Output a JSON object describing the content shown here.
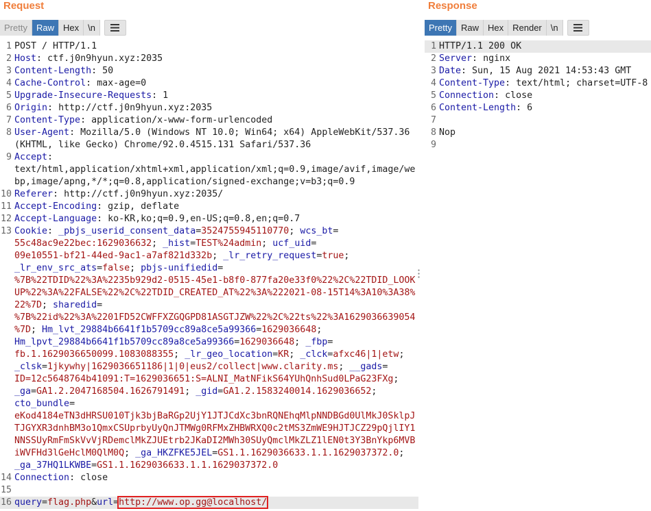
{
  "request": {
    "title": "Request",
    "tabs": {
      "pretty": "Pretty",
      "raw": "Raw",
      "hex": "Hex",
      "newline": "\\n"
    },
    "lines": {
      "l1": "POST / HTTP/1.1",
      "host_k": "Host",
      "host_v": " ctf.j0n9hyun.xyz:2035",
      "cl_k": "Content-Length",
      "cl_v": " 50",
      "cc_k": "Cache-Control",
      "cc_v": " max-age=0",
      "uir_k": "Upgrade-Insecure-Requests",
      "uir_v": " 1",
      "or_k": "Origin",
      "or_v": " http://ctf.j0n9hyun.xyz:2035",
      "ct_k": "Content-Type",
      "ct_v": " application/x-www-form-urlencoded",
      "ua_k": "User-Agent",
      "ua_v": " Mozilla/5.0 (Windows NT 10.0; Win64; x64) AppleWebKit/537.36",
      "ua_v2": "(KHTML, like Gecko) Chrome/92.0.4515.131 Safari/537.36",
      "ac_k": "Accept",
      "ac_v1": "text/html,application/xhtml+xml,application/xml;q=0.9,image/avif,image/we",
      "ac_v2": "bp,image/apng,*/*;q=0.8,application/signed-exchange;v=b3;q=0.9",
      "ref_k": "Referer",
      "ref_v": " http://ctf.j0n9hyun.xyz:2035/",
      "ae_k": "Accept-Encoding",
      "ae_v": " gzip, deflate",
      "al_k": "Accept-Language",
      "al_v": " ko-KR,ko;q=0.9,en-US;q=0.8,en;q=0.7",
      "ck_k": "Cookie",
      "ck1a": "_pbjs_userid_consent_data",
      "ck1b": "3524755945110770",
      "ck1c": "wcs_bt",
      "ck2a": "55c48ac9e22bec:1629036632",
      "ck2b": "_hist",
      "ck2c": "TEST%24admin",
      "ck2d": "ucf_uid",
      "ck3a": "09e10551-bf21-44ed-9ac1-a7af821d332b",
      "ck3b": "_lr_retry_request",
      "ck3c": "true",
      "ck4a": "_lr_env_src_ats",
      "ck4b": "false",
      "ck4c": "pbjs-unifiedid",
      "ck5": "%7B%22TDID%22%3A%2235b929d2-0515-45e1-b8f0-877fa20e33f0%22%2C%22TDID_LOOK",
      "ck6": "UP%22%3A%22FALSE%22%2C%22TDID_CREATED_AT%22%3A%222021-08-15T14%3A10%3A38%",
      "ck7a": "22%7D",
      "ck7b": "sharedid",
      "ck8": "%7B%22id%22%3A%2201FD52CWFFXZGQGPD81ASGTJZW%22%2C%22ts%22%3A1629036639054",
      "ck9a": "%7D",
      "ck9b": "Hm_lvt_29884b6641f1b5709cc89a8ce5a99366",
      "ck9c": "1629036648",
      "ck10a": "Hm_lpvt_29884b6641f1b5709cc89a8ce5a99366",
      "ck10b": "1629036648",
      "ck10c": "_fbp",
      "ck11a": "fb.1.1629036650099.1083088355",
      "ck11b": "_lr_geo_location",
      "ck11c": "KR",
      "ck11d": "_clck",
      "ck11e": "afxc46|1|etw",
      "ck12a": "_clsk",
      "ck12b": "1jkywhy|1629036651186|1|0|eus2/collect|www.clarity.ms",
      "ck12c": "__gads",
      "ck13a": "ID=12c5648764b41091:T=1629036651:S=ALNI_MatNFikS64YUhQnhSud0LPaG23FXg",
      "ck14a": "_ga",
      "ck14b": "GA1.2.2047168504.1626791491",
      "ck14c": "_gid",
      "ck14d": "GA1.2.1583240014.1629036652",
      "ck15a": "cto_bundle",
      "ck16": "eKod4184eTN3dHRSU010Tjk3bjBaRGp2UjY1JTJCdXc3bnRQNEhqMlpNNDBGd0UlMkJ0SklpJ",
      "ck17": "TJGYXR3dnhBM3o1QmxCSUprbyUyQnJTMWg0RFMxZHBWRXQ0c2tMS3ZmWE9HJTJCZ29pQjlIY1",
      "ck18": "NNSSUyRmFmSkVvVjRDemclMkZJUEtrb2JKaDI2MWh30SUyQmclMkZLZ1lEN0t3Y3BnYkp6MVB",
      "ck19a": "iWVFHd3lGeHclM0QlM0Q",
      "ck19b": "_ga_HKZFKE5JEL",
      "ck19c": "GS1.1.1629036633.1.1.1629037372.0",
      "ck20a": "_ga_37HQ1LKWBE",
      "ck20b": "GS1.1.1629036633.1.1.1629037372.0",
      "conn_k": "Connection",
      "conn_v": " close",
      "b_k1": "query",
      "b_v1": "flag.php",
      "b_k2": "url",
      "b_v2": "http://www.op.gg@localhost/"
    }
  },
  "response": {
    "title": "Response",
    "tabs": {
      "pretty": "Pretty",
      "raw": "Raw",
      "hex": "Hex",
      "render": "Render",
      "newline": "\\n"
    },
    "lines": {
      "l1": "HTTP/1.1 200 OK",
      "sv_k": "Server",
      "sv_v": " nginx",
      "dt_k": "Date",
      "dt_v": " Sun, 15 Aug 2021 14:53:43 GMT",
      "ct_k": "Content-Type",
      "ct_v": " text/html; charset=UTF-8",
      "cn_k": "Connection",
      "cn_v": " close",
      "cl_k": "Content-Length",
      "cl_v": " 6",
      "body": "Nop"
    }
  },
  "colors": {
    "accent": "#f07e3b",
    "active_tab": "#3d76b4",
    "header_key": "#1a1aa6",
    "cookie_value": "#a31515",
    "highlight": "#e02020"
  }
}
